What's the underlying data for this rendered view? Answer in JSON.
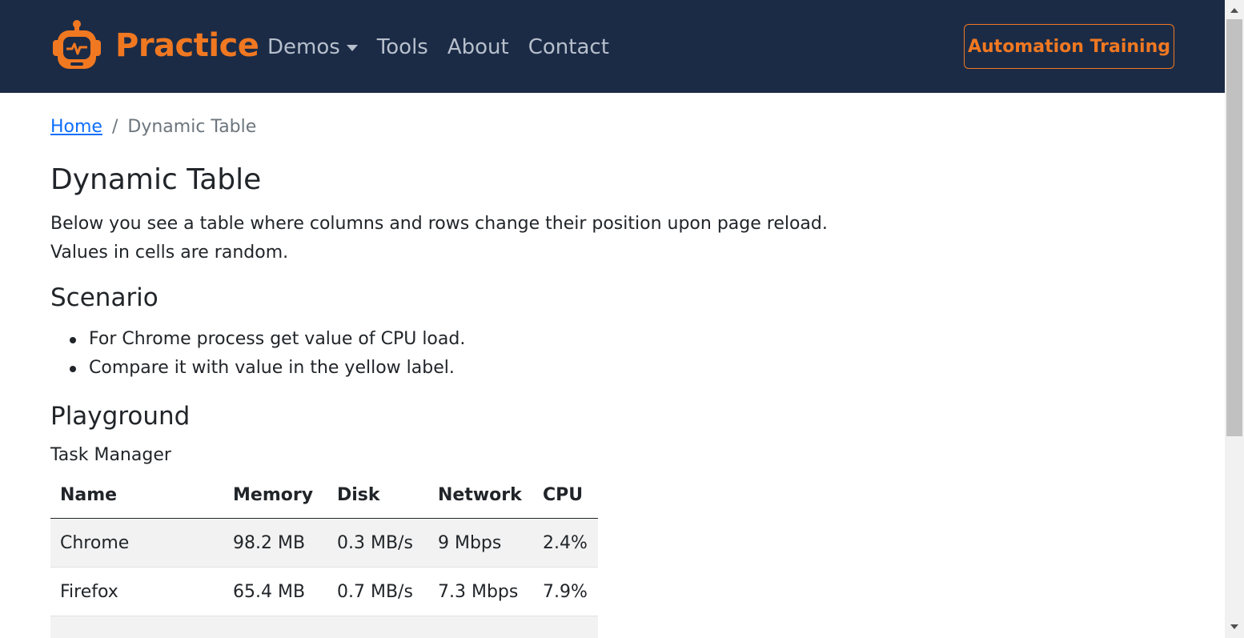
{
  "navbar": {
    "brand_text": "Practice",
    "links": [
      {
        "label": "Demos",
        "has_caret": true
      },
      {
        "label": "Tools"
      },
      {
        "label": "About"
      },
      {
        "label": "Contact"
      }
    ],
    "cta_label": "Automation Training",
    "background_color": "#1b2b46",
    "accent_color": "#f07821",
    "logo_icon": "robot-head-icon"
  },
  "breadcrumb": {
    "home_label": "Home",
    "separator": "/",
    "current_label": "Dynamic Table"
  },
  "page": {
    "title": "Dynamic Table",
    "description_line1": "Below you see a table where columns and rows change their position upon page reload.",
    "description_line2": "Values in cells are random.",
    "scenario_title": "Scenario",
    "scenario_items": [
      "For Chrome process get value of CPU load.",
      "Compare it with value in the yellow label."
    ],
    "playground_title": "Playground",
    "table_caption": "Task Manager"
  },
  "table": {
    "headers": [
      "Name",
      "Memory",
      "Disk",
      "Network",
      "CPU"
    ],
    "rows": [
      [
        "Chrome",
        "98.2 MB",
        "0.3 MB/s",
        "9 Mbps",
        "2.4%"
      ],
      [
        "Firefox",
        "65.4 MB",
        "0.7 MB/s",
        "7.3 Mbps",
        "7.9%"
      ]
    ]
  }
}
